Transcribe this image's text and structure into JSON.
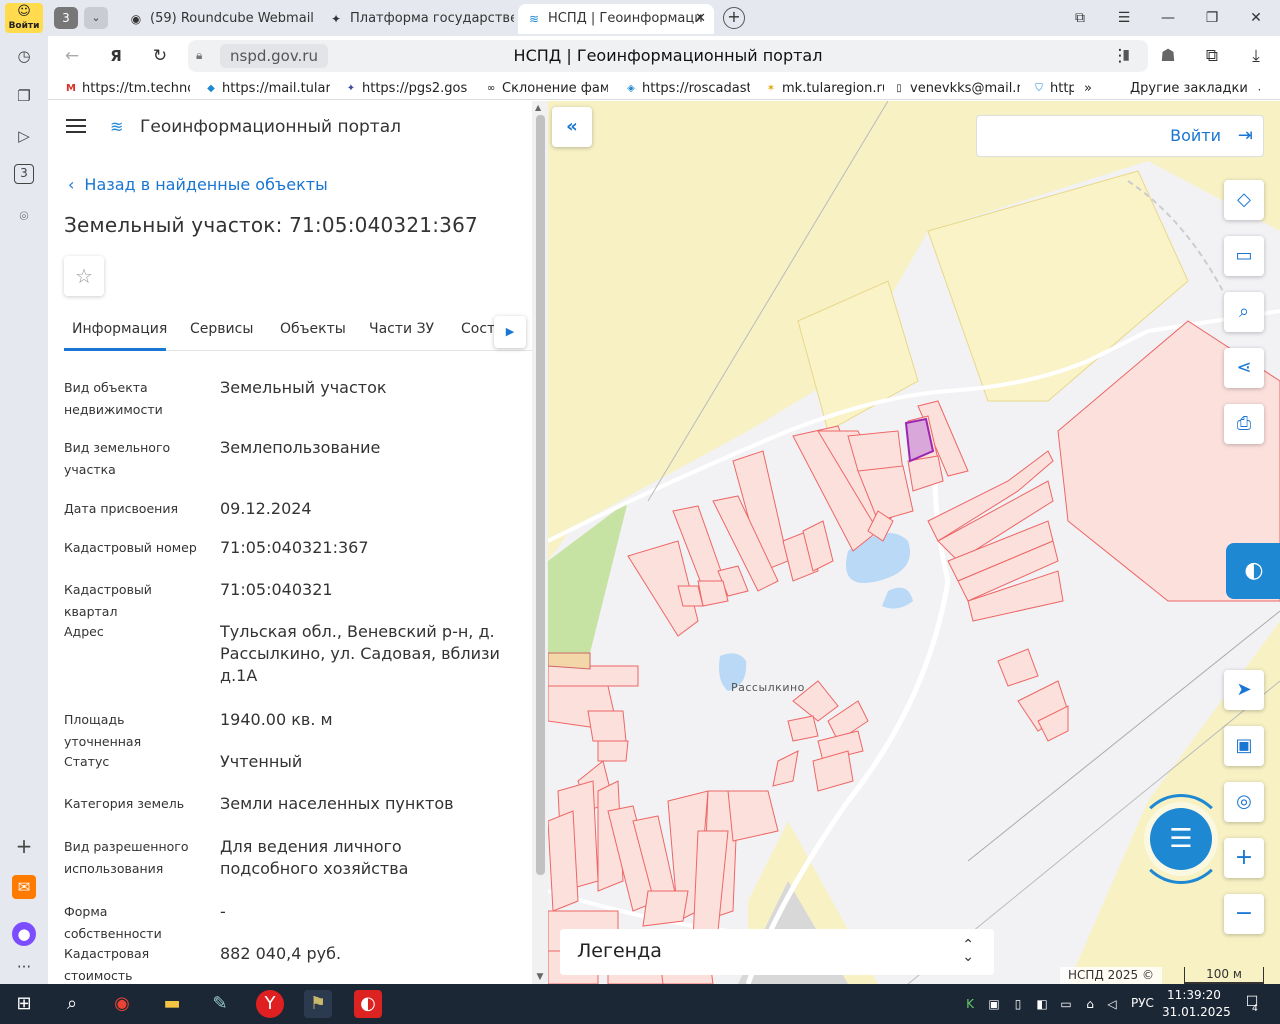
{
  "browser": {
    "login_badge": "Войти",
    "tab_counter": "3",
    "tabs": [
      {
        "label": "(59) Roundcube Webmail :"
      },
      {
        "label": "Платформа государстве"
      },
      {
        "label": "НСПД | Геоинформаци"
      }
    ],
    "address": {
      "domain": "nspd.gov.ru",
      "page_title": "НСПД | Геоинформационный портал"
    },
    "bookmarks": [
      {
        "label": "https://tm.technol"
      },
      {
        "label": "https://mail.tulare"
      },
      {
        "label": "https://pgs2.gosu"
      },
      {
        "label": "Склонение фами"
      },
      {
        "label": "https://roscadastr"
      },
      {
        "label": "mk.tularegion.ru"
      },
      {
        "label": "venevkks@mail.ru"
      },
      {
        "label": "http"
      }
    ],
    "bookmarks_more": "»",
    "other_bookmarks": "Другие закладки",
    "sidebar_counter": "3"
  },
  "portal": {
    "title": "Геоинформационный портал",
    "back_link": "Назад в найденные объекты",
    "object_title": "Земельный участок: 71:05:040321:367",
    "tabs": [
      {
        "label": "Информация"
      },
      {
        "label": "Сервисы"
      },
      {
        "label": "Объекты"
      },
      {
        "label": "Части ЗУ"
      },
      {
        "label": "Соста"
      }
    ],
    "info": [
      {
        "label": "Вид объекта недвижимости",
        "value": "Земельный участок"
      },
      {
        "label": "Вид земельного участка",
        "value": "Землепользование"
      },
      {
        "label": "Дата присвоения",
        "value": "09.12.2024"
      },
      {
        "label": "Кадастровый номер",
        "value": "71:05:040321:367"
      },
      {
        "label": "Кадастровый квартал",
        "value": "71:05:040321"
      },
      {
        "label": "Адрес",
        "value": "Тульская обл., Веневский р-н, д. Рассылкино, ул. Садовая, вблизи д.1А"
      },
      {
        "label": "Площадь уточненная",
        "value": "1940.00 кв. м"
      },
      {
        "label": "Статус",
        "value": "Учтенный"
      },
      {
        "label": "Категория земель",
        "value": "Земли населенных пунктов"
      },
      {
        "label": "Вид разрешенного использования",
        "value": "Для ведения личного подсобного хозяйства"
      },
      {
        "label": "Форма собственности",
        "value": "-"
      },
      {
        "label": "Кадастровая стоимость",
        "value": "882 040,4 руб."
      }
    ]
  },
  "map": {
    "login_label": "Войти",
    "legend_label": "Легенда",
    "place_label": "Рассылкино",
    "copyright": "НСПД 2025 ©",
    "scale": "100 м"
  },
  "taskbar": {
    "lang": "РУС",
    "time": "11:39:20",
    "date": "31.01.2025",
    "notifications": "4"
  }
}
